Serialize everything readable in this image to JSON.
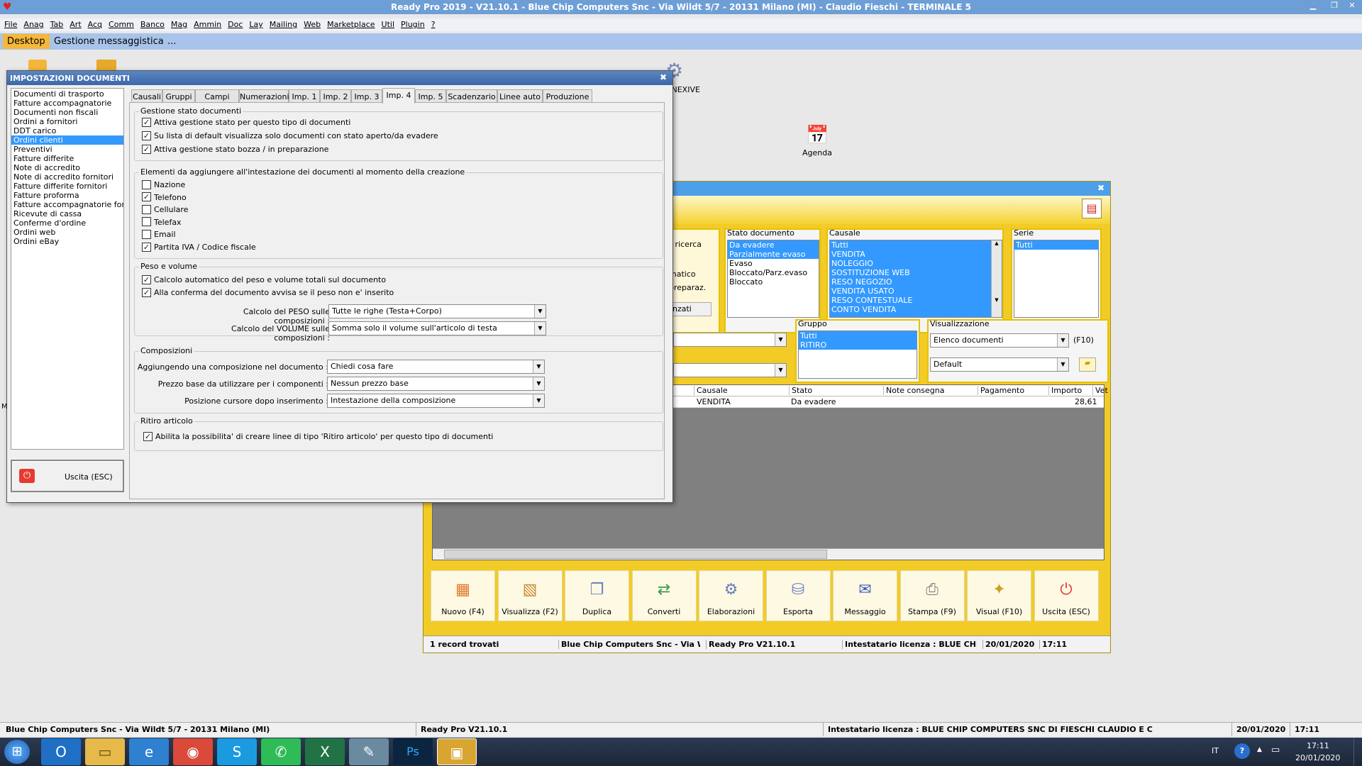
{
  "window_title": "Ready Pro 2019 - V21.10.1 - Blue Chip Computers Snc - Via Wildt 5/7 - 20131 Milano (MI) - Claudio Fieschi - TERMINALE 5",
  "menu": [
    "File",
    "Anag",
    "Tab",
    "Art",
    "Acq",
    "Comm",
    "Banco",
    "Mag",
    "Ammin",
    "Doc",
    "Lay",
    "Mailing",
    "Web",
    "Marketplace",
    "Util",
    "Plugin",
    "?"
  ],
  "tabs": {
    "desktop": "Desktop",
    "messaggistica": "Gestione messaggistica",
    "more": "..."
  },
  "desktop_icons": {
    "nexive": "G-NEXIVE",
    "agenda": "Agenda"
  },
  "dialog": {
    "title": "IMPOSTAZIONI DOCUMENTI",
    "doc_types": [
      "Documenti di trasporto",
      "Fatture accompagnatorie",
      "Documenti non fiscali",
      "Ordini a fornitori",
      "DDT carico",
      "Ordini clienti",
      "Preventivi",
      "Fatture differite",
      "Note di accredito",
      "Note di accredito fornitori",
      "Fatture differite fornitori",
      "Fatture proforma",
      "Fatture accompagnatorie fornito",
      "Ricevute di cassa",
      "Conferme d'ordine",
      "Ordini web",
      "Ordini eBay"
    ],
    "selected_type": "Ordini clienti",
    "exit_label": "Uscita (ESC)",
    "tabs": [
      "Causali",
      "Gruppi",
      "Campi agg.",
      "Numerazioni",
      "Imp. 1",
      "Imp. 2",
      "Imp. 3",
      "Imp. 4",
      "Imp. 5",
      "Scadenzario",
      "Linee auto",
      "Produzione"
    ],
    "active_tab": "Imp. 4",
    "g1": {
      "title": "Gestione stato documenti",
      "items": [
        {
          "label": "Attiva gestione stato per questo tipo di documenti",
          "checked": true
        },
        {
          "label": "Su lista di default visualizza solo documenti con stato aperto/da evadere",
          "checked": true
        },
        {
          "label": "Attiva gestione stato bozza / in preparazione",
          "checked": true
        }
      ]
    },
    "g2": {
      "title": "Elementi da aggiungere all'intestazione dei documenti al momento della creazione",
      "items": [
        {
          "label": "Nazione",
          "checked": false
        },
        {
          "label": "Telefono",
          "checked": true
        },
        {
          "label": "Cellulare",
          "checked": false
        },
        {
          "label": "Telefax",
          "checked": false
        },
        {
          "label": "Email",
          "checked": false
        },
        {
          "label": "Partita IVA / Codice fiscale",
          "checked": true
        }
      ]
    },
    "g3": {
      "title": "Peso e volume",
      "items": [
        {
          "label": "Calcolo automatico del peso e volume totali sul documento",
          "checked": true
        },
        {
          "label": "Alla conferma del documento avvisa se il peso non e' inserito",
          "checked": true
        }
      ],
      "peso_label": "Calcolo del PESO sulle composizioni :",
      "peso_value": "Tutte le righe (Testa+Corpo)",
      "volume_label": "Calcolo del VOLUME sulle composizioni :",
      "volume_value": "Somma solo il volume sull'articolo di testa"
    },
    "g4": {
      "title": "Composizioni",
      "c1_label": "Aggiungendo una composizione nel documento :",
      "c1_value": "Chiedi cosa fare",
      "c2_label": "Prezzo base da utilizzare per i componenti :",
      "c2_value": "Nessun prezzo base",
      "c3_label": "Posizione cursore dopo inserimento :",
      "c3_value": "Intestazione della composizione"
    },
    "g5": {
      "title": "Ritiro articolo",
      "item": {
        "label": "Abilita la possibilita' di creare linee di tipo 'Ritiro articolo' per questo tipo di documenti",
        "checked": true
      }
    }
  },
  "bg": {
    "partial_labels": [
      "i ricerca",
      "matico",
      "preparaz.",
      "nzati"
    ],
    "stato": {
      "title": "Stato documento",
      "items": [
        "Da evadere",
        "Parzialmente evaso",
        "Evaso",
        "Bloccato/Parz.evaso",
        "Bloccato"
      ]
    },
    "causale": {
      "title": "Causale",
      "items": [
        "Tutti",
        "VENDITA",
        "NOLEGGIO",
        "SOSTITUZIONE WEB",
        "RESO NEGOZIO",
        "VENDITA USATO",
        "RESO CONTESTUALE",
        "CONTO VENDITA"
      ]
    },
    "serie": {
      "title": "Serie",
      "items": [
        "Tutti"
      ]
    },
    "gruppo": {
      "title": "Gruppo",
      "items": [
        "Tutti",
        "RITIRO"
      ]
    },
    "vis": {
      "title": "Visualizzazione",
      "value1": "Elenco documenti",
      "f10": "(F10)",
      "value2": "Default"
    },
    "table": {
      "headers": [
        "Causale",
        "Stato",
        "Note consegna",
        "Pagamento",
        "Importo",
        "Vet"
      ],
      "row": {
        "causale": "VENDITA",
        "stato": "Da evadere",
        "importo": "28,61"
      }
    },
    "buttons": [
      "Nuovo (F4)",
      "Visualizza (F2)",
      "Duplica",
      "Converti",
      "Elaborazioni",
      "Esporta",
      "Messaggio",
      "Stampa (F9)",
      "Visual (F10)",
      "Uscita (ESC)"
    ],
    "status": [
      "1 record trovati",
      "Blue Chip Computers Snc - Via Wil",
      "Ready Pro V21.10.1",
      "Intestatario licenza : BLUE CHIP C",
      "20/01/2020",
      "17:11"
    ]
  },
  "statusbar": {
    "company": "Blue Chip Computers Snc - Via Wildt 5/7 - 20131 Milano (MI)",
    "version": "Ready Pro V21.10.1",
    "license": "Intestatario licenza : BLUE CHIP COMPUTERS SNC DI FIESCHI CLAUDIO E C",
    "date": "20/01/2020",
    "time": "17:11"
  },
  "tray": {
    "lang": "IT",
    "time": "17:11",
    "date": "20/01/2020"
  }
}
